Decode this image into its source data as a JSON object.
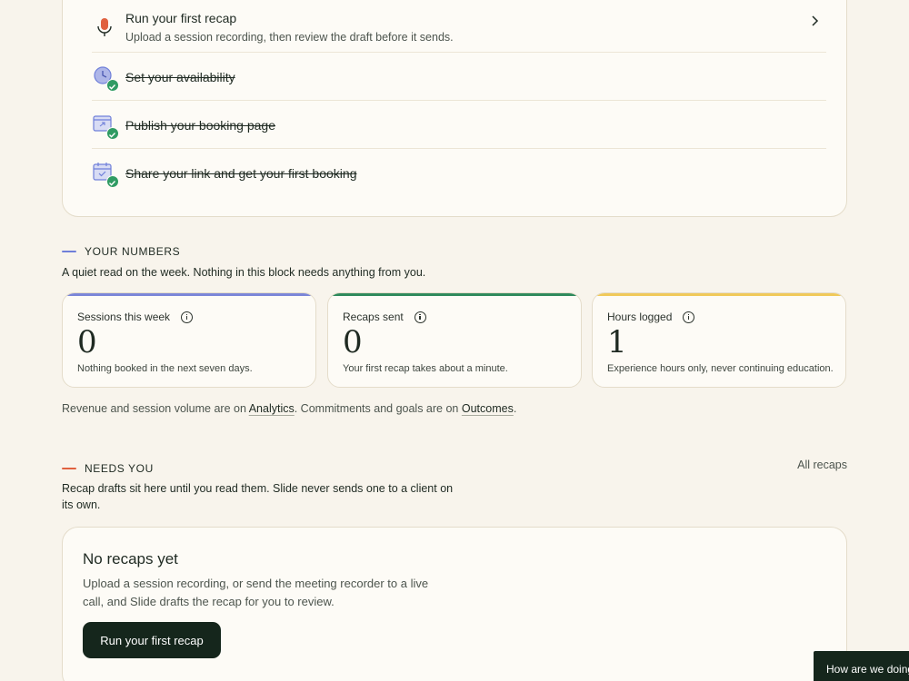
{
  "onboarding": {
    "steps": [
      {
        "title": "Run your first recap",
        "subtitle": "Upload a session recording, then review the draft before it sends.",
        "icon": "microphone-icon",
        "done": false
      },
      {
        "title": "Set your availability",
        "icon": "clock-icon",
        "done": true
      },
      {
        "title": "Publish your booking page",
        "icon": "browser-window-icon",
        "done": true
      },
      {
        "title": "Share your link and get your first booking",
        "icon": "calendar-icon",
        "done": true
      }
    ]
  },
  "numbers": {
    "label": "YOUR NUMBERS",
    "description": "A quiet read on the week. Nothing in this block needs anything from you.",
    "accent": "#6f7fd9",
    "metrics": [
      {
        "label": "Sessions this week",
        "value": "0",
        "note": "Nothing booked in the next seven days.",
        "color": "#7b86d8"
      },
      {
        "label": "Recaps sent",
        "value": "0",
        "note": "Your first recap takes about a minute.",
        "color": "#2f8a5c"
      },
      {
        "label": "Hours logged",
        "value": "1",
        "note": "Experience hours only, never continuing education.",
        "color": "#f0c95a"
      }
    ],
    "footer": {
      "prefix": "Revenue and session volume are on ",
      "analytics_link": "Analytics",
      "middle": ". Commitments and goals are on ",
      "outcomes_link": "Outcomes",
      "suffix": "."
    }
  },
  "needs_you": {
    "label": "NEEDS YOU",
    "accent": "#e0613f",
    "description": "Recap drafts sit here until you read them. Slide never sends one to a client on its own.",
    "all_recaps_link": "All recaps",
    "empty": {
      "title": "No recaps yet",
      "body": "Upload a session recording, or send the meeting recorder to a live call, and Slide drafts the recap for you to review.",
      "button": "Run your first recap"
    }
  },
  "feedback_tab": "How are we doing?"
}
